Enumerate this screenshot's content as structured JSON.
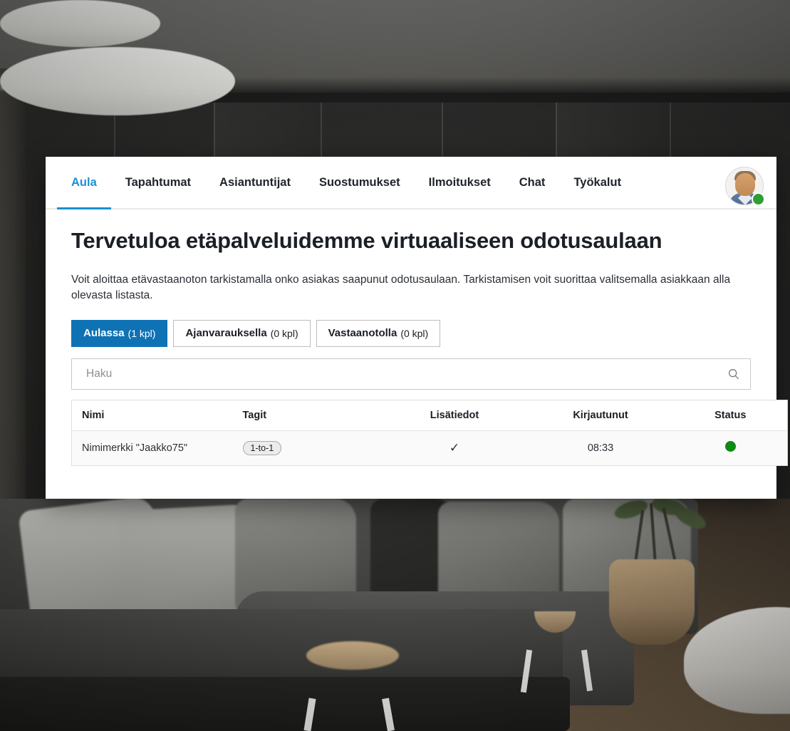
{
  "nav": {
    "tabs": [
      {
        "label": "Aula",
        "active": true
      },
      {
        "label": "Tapahtumat",
        "active": false
      },
      {
        "label": "Asiantuntijat",
        "active": false
      },
      {
        "label": "Suostumukset",
        "active": false
      },
      {
        "label": "Ilmoitukset",
        "active": false
      },
      {
        "label": "Chat",
        "active": false
      },
      {
        "label": "Työkalut",
        "active": false
      }
    ],
    "avatar_icon": "user-avatar-photo",
    "presence_status": "online",
    "presence_color": "#2e9e35",
    "active_tab_color": "#1c8fd4"
  },
  "main": {
    "title": "Tervetuloa etäpalveluidemme virtuaaliseen odotusaulaan",
    "intro": "Voit aloittaa etävastaanoton tarkistamalla onko asiakas saapunut odotusaulaan. Tarkistamisen voit suorittaa valitsemalla asiakkaan alla olevasta listasta."
  },
  "filters": {
    "accent_color": "#0f72b5",
    "items": [
      {
        "label": "Aulassa",
        "count": "(1 kpl)",
        "active": true
      },
      {
        "label": "Ajanvarauksella",
        "count": "(0 kpl)",
        "active": false
      },
      {
        "label": "Vastaanotolla",
        "count": "(0 kpl)",
        "active": false
      }
    ]
  },
  "search": {
    "placeholder": "Haku",
    "value": "",
    "icon": "search-icon"
  },
  "table": {
    "columns": [
      "Nimi",
      "Tagit",
      "Lisätiedot",
      "Kirjautunut",
      "Status"
    ],
    "rows": [
      {
        "nimi": "Nimimerkki \"Jaakko75\"",
        "tagit": "1-to-1",
        "lisatiedot": "✓",
        "kirjautunut": "08:33",
        "status": "online",
        "status_color": "#0d8a13"
      }
    ]
  }
}
